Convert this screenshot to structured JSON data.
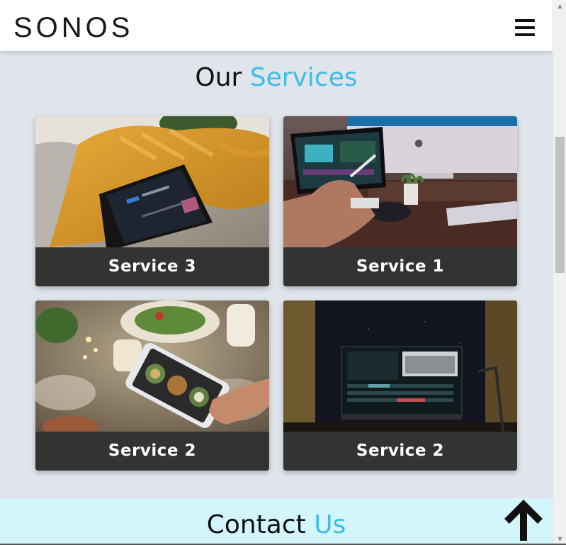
{
  "header": {
    "logo_text": "SONOS",
    "menu_icon": "hamburger-menu-icon"
  },
  "services": {
    "title_plain": "Our",
    "title_accent": "Services",
    "cards": [
      {
        "label": "Service 3",
        "image": "tablet-on-couch-photo"
      },
      {
        "label": "Service 1",
        "image": "tablet-stylus-desk-photo"
      },
      {
        "label": "Service 2",
        "image": "phone-food-table-photo"
      },
      {
        "label": "Service 2",
        "image": "laptop-video-editing-photo"
      }
    ]
  },
  "contact": {
    "title_plain": "Contact",
    "title_accent": "Us"
  },
  "back_to_top_icon": "arrow-up-icon",
  "colors": {
    "accent": "#3cbde8",
    "page_bg": "#dfe5ea",
    "card_label_bg": "#333333",
    "contact_bg": "#d2f6fc",
    "header_bg": "#ffffff"
  }
}
